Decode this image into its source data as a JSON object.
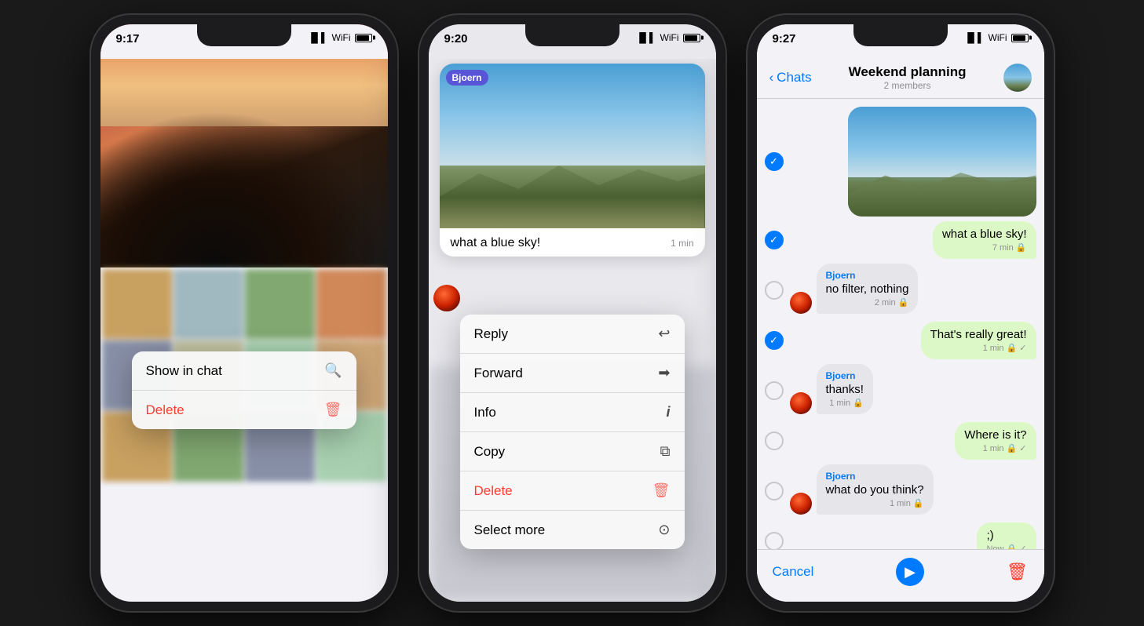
{
  "phone1": {
    "time": "9:17",
    "context_menu": {
      "items": [
        {
          "label": "Show in chat",
          "icon": "🔍",
          "danger": false
        },
        {
          "label": "Delete",
          "icon": "🗑",
          "danger": true
        }
      ]
    }
  },
  "phone2": {
    "time": "9:20",
    "sender": "Bjoern",
    "message_text": "what a blue sky!",
    "message_time": "1 min",
    "context_menu": {
      "items": [
        {
          "label": "Reply",
          "icon": "↩",
          "danger": false
        },
        {
          "label": "Forward",
          "icon": "→",
          "danger": false
        },
        {
          "label": "Info",
          "icon": "i",
          "danger": false
        },
        {
          "label": "Copy",
          "icon": "⧉",
          "danger": false
        },
        {
          "label": "Delete",
          "icon": "🗑",
          "danger": true
        },
        {
          "label": "Select more",
          "icon": "⊙",
          "danger": false
        }
      ]
    }
  },
  "phone3": {
    "time": "9:27",
    "header": {
      "back_label": "Chats",
      "title": "Weekend planning",
      "subtitle": "2 members"
    },
    "messages": [
      {
        "type": "image",
        "outgoing": true
      },
      {
        "type": "text",
        "outgoing": true,
        "text": "what a blue sky!",
        "time": "7 min",
        "sender": ""
      },
      {
        "type": "text",
        "outgoing": false,
        "sender": "Bjoern",
        "text": "no filter, nothing",
        "time": "2 min"
      },
      {
        "type": "text",
        "outgoing": true,
        "text": "That's really great!",
        "time": "1 min",
        "sender": ""
      },
      {
        "type": "text",
        "outgoing": false,
        "sender": "Bjoern",
        "text": "thanks!",
        "time": "1 min"
      },
      {
        "type": "text",
        "outgoing": true,
        "text": "Where is it?",
        "time": "1 min",
        "sender": ""
      },
      {
        "type": "text",
        "outgoing": false,
        "sender": "Bjoern",
        "text": "what do you think?",
        "time": "1 min"
      },
      {
        "type": "text",
        "outgoing": true,
        "text": ";)",
        "time": "Now",
        "sender": ""
      }
    ],
    "bottom_bar": {
      "cancel": "Cancel",
      "forward_icon": "▶",
      "delete_icon": "🗑"
    }
  }
}
